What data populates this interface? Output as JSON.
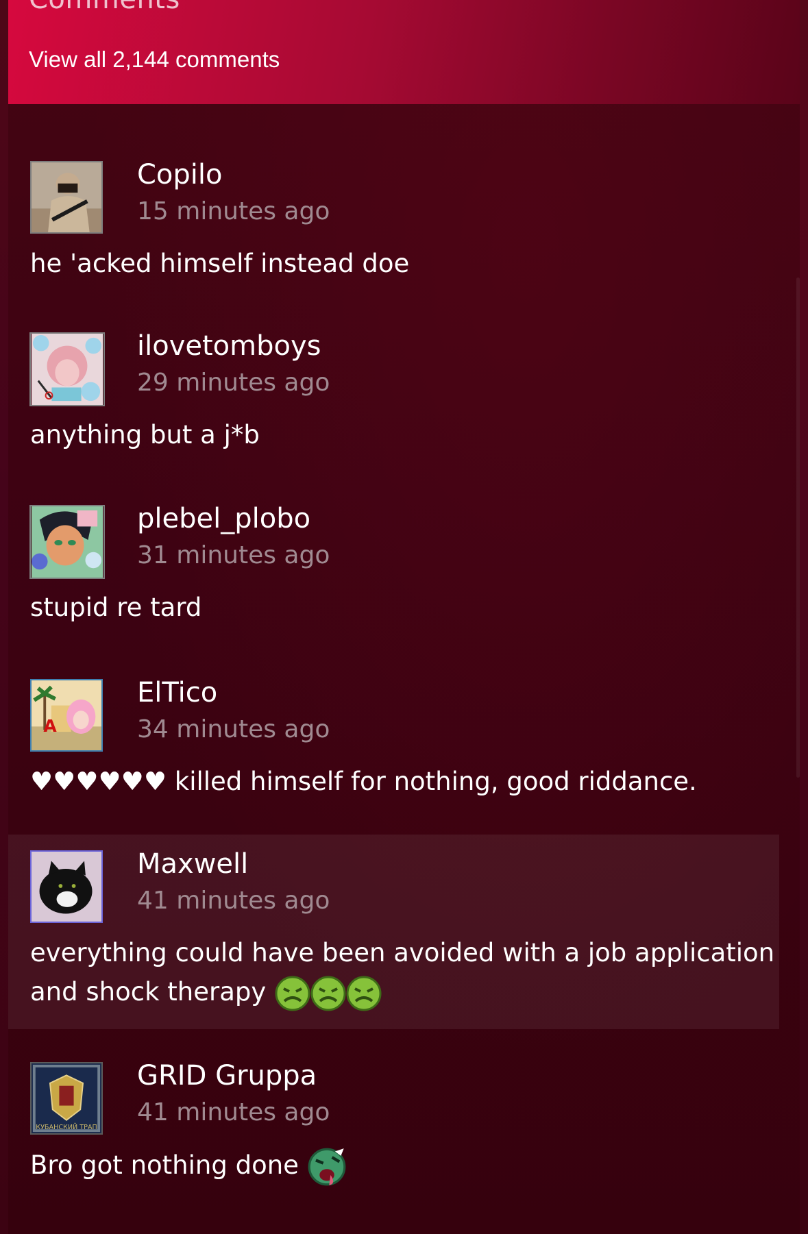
{
  "header": {
    "title": "Comments",
    "view_all_label": "View all 2,144 comments"
  },
  "comments": [
    {
      "author": "Copilo",
      "time": "15 minutes ago",
      "text": "he 'acked himself instead doe",
      "avatar_icon": "soldier-avatar-icon"
    },
    {
      "author": "ilovetomboys",
      "time": "29 minutes ago",
      "text": "anything but a j*b",
      "avatar_icon": "anime-girl-avatar-icon"
    },
    {
      "author": "plebel_plobo",
      "time": "31 minutes ago",
      "text": "stupid re tard",
      "avatar_icon": "anime-boy-avatar-icon"
    },
    {
      "author": "ElTico",
      "time": "34 minutes ago",
      "text": "♥♥♥♥♥♥ killed himself for nothing, good riddance.",
      "avatar_icon": "palm-tree-avatar-icon"
    },
    {
      "author": "Maxwell",
      "time": "41 minutes ago",
      "text_line1": "everything could have been avoided with a job application",
      "text_line2": "and shock therapy",
      "emotes": [
        "sick-face-emote-icon",
        "sick-face-emote-icon",
        "sick-face-emote-icon"
      ],
      "avatar_icon": "black-cat-avatar-icon"
    },
    {
      "author": "GRID Gruppa",
      "time": "41 minutes ago",
      "text": "Bro got nothing done",
      "emotes": [
        "vomit-face-emote-icon"
      ],
      "avatar_icon": "crest-avatar-icon",
      "avatar_caption": "КУБАНСКИЙ ТРАП"
    }
  ],
  "colors": {
    "header_accent": "#d6093e",
    "background": "#3f0310",
    "timestamp": "#a08a91",
    "text": "#ffffff"
  }
}
